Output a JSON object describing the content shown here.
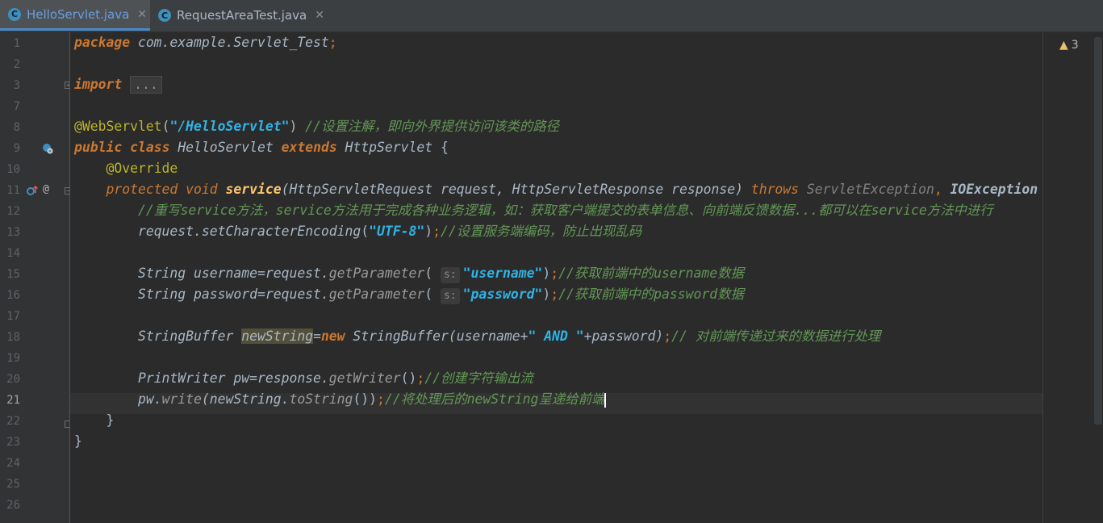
{
  "tabs": [
    {
      "label": "HelloServlet.java",
      "icon": "C",
      "active": true
    },
    {
      "label": "RequestAreaTest.java",
      "icon": "C",
      "active": false
    }
  ],
  "warnings": {
    "count": "3"
  },
  "line_numbers": [
    "1",
    "2",
    "3",
    "7",
    "8",
    "9",
    "10",
    "11",
    "12",
    "13",
    "14",
    "15",
    "16",
    "17",
    "18",
    "19",
    "20",
    "21",
    "22",
    "23",
    "24",
    "25",
    "26"
  ],
  "code": {
    "l1_kw": "package",
    "l1_rest": " com.example.Servlet_Test",
    "l1_semi": ";",
    "l3_kw": "import",
    "l3_fold": "...",
    "l8_ann": "@WebServlet",
    "l8_p1": "(",
    "l8_str": "\"/HelloServlet\"",
    "l8_p2": ") ",
    "l8_cmt": "//设置注解，即向外界提供访问该类的路径",
    "l9_kw1": "public",
    "l9_kw2": "class",
    "l9_name": "HelloServlet",
    "l9_kw3": "extends",
    "l9_super": "HttpServlet",
    "l9_brace": " {",
    "l10_ann": "@Override",
    "l11_kw1": "protected",
    "l11_kw2": "void",
    "l11_meth": "service",
    "l11_params": "(HttpServletRequest request, HttpServletResponse response) ",
    "l11_kw3": "throws",
    "l11_exc1": "ServletException",
    "l11_comma": ",",
    "l11_exc2": "IOException",
    "l11_brace": " {",
    "l12_cmt": "//重写service方法，service方法用于完成各种业务逻辑，如：获取客户端提交的表单信息、向前端反馈数据...都可以在service方法中进行",
    "l13_obj": "request.",
    "l13_call": "setCharacterEncoding",
    "l13_p1": "(",
    "l13_str": "\"UTF-8\"",
    "l13_p2": ")",
    "l13_semi": ";",
    "l13_cmt": "//设置服务端编码，防止出现乱码",
    "l15_decl": "String username=request.",
    "l15_call": "getParameter",
    "l15_p1": "(",
    "l15_hint": "s:",
    "l15_str": "\"username\"",
    "l15_p2": ")",
    "l15_semi": ";",
    "l15_cmt": "//获取前端中的username数据",
    "l16_decl": "String password=request.",
    "l16_call": "getParameter",
    "l16_p1": "(",
    "l16_hint": "s:",
    "l16_str": "\"password\"",
    "l16_p2": ")",
    "l16_semi": ";",
    "l16_cmt": "//获取前端中的password数据",
    "l18_type": "StringBuffer ",
    "l18_var": "newString",
    "l18_eq": "=",
    "l18_new": "new",
    "l18_rest1": " StringBuffer(username+",
    "l18_str": "\" AND \"",
    "l18_rest2": "+password)",
    "l18_semi": ";",
    "l18_cmt": "// 对前端传递过来的数据进行处理",
    "l20_decl": "PrintWriter pw=response.",
    "l20_call": "getWriter",
    "l20_p": "()",
    "l20_semi": ";",
    "l20_cmt": "//创建字符输出流",
    "l21_obj": "pw.",
    "l21_call": "write",
    "l21_p1": "(newString.",
    "l21_call2": "toString",
    "l21_p2": "())",
    "l21_semi": ";",
    "l21_cmt": "//将处理后的newString呈递给前端",
    "l22_brace": "}",
    "l23_brace": "}"
  }
}
